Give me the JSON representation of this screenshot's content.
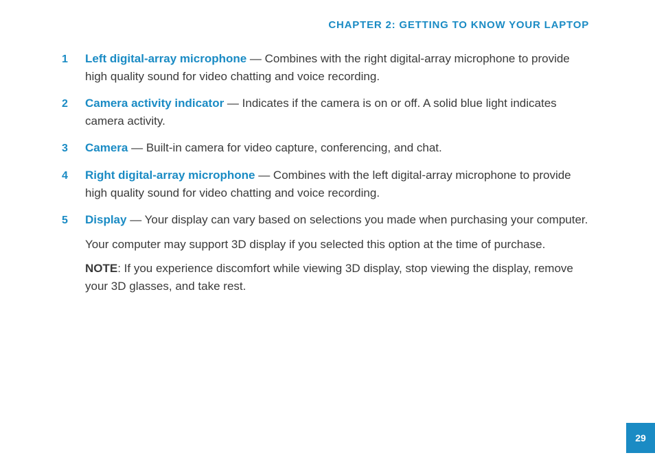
{
  "header": "CHAPTER 2: GETTING TO KNOW YOUR LAPTOP",
  "accent_color": "#1a8bc4",
  "items": [
    {
      "num": "1",
      "term": "Left digital-array microphone",
      "desc": " — Combines with the right digital-array microphone to provide high quality sound for video chatting and voice recording."
    },
    {
      "num": "2",
      "term": "Camera activity indicator",
      "desc": " — Indicates if the camera is on or off. A solid blue light indicates camera activity."
    },
    {
      "num": "3",
      "term": "Camera",
      "desc": " — Built-in camera for video capture, conferencing, and chat."
    },
    {
      "num": "4",
      "term": "Right digital-array microphone",
      "desc": " — Combines with the left digital-array microphone to provide high quality sound for video chatting and voice recording."
    },
    {
      "num": "5",
      "term": "Display",
      "desc": " — Your display can vary based on selections you made when purchasing your computer.",
      "sub1": "Your computer may support 3D display if you selected this option at the time of purchase.",
      "note_label": "NOTE",
      "note_body": ": If you experience discomfort while viewing 3D display, stop viewing the display, remove your 3D glasses, and take rest."
    }
  ],
  "page_number": "29"
}
